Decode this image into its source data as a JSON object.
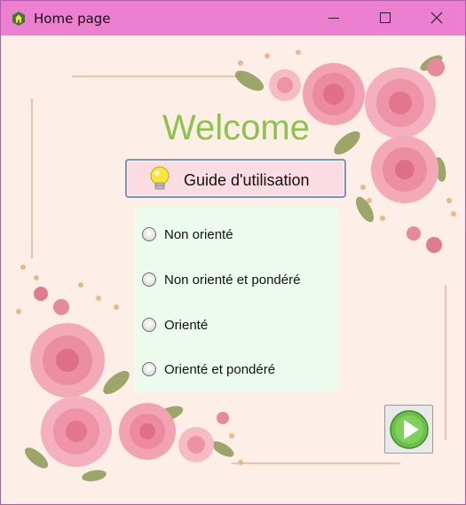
{
  "window": {
    "title": "Home page"
  },
  "main": {
    "heading": "Welcome",
    "guide_button_label": "Guide d'utilisation",
    "options": [
      {
        "label": "Non orienté"
      },
      {
        "label": "Non orienté et pondéré"
      },
      {
        "label": "Orienté"
      },
      {
        "label": "Orienté et pondéré"
      }
    ]
  },
  "colors": {
    "titlebar": "#ec7fcf",
    "background": "#fdefe8",
    "heading": "#8cc34a",
    "options_panel": "#edfaee",
    "guide_button": "#fbdce2",
    "next_arrow": "#6cc04a"
  },
  "icons": {
    "app": "home-icon",
    "guide": "lightbulb-icon",
    "next": "play-arrow-icon"
  }
}
